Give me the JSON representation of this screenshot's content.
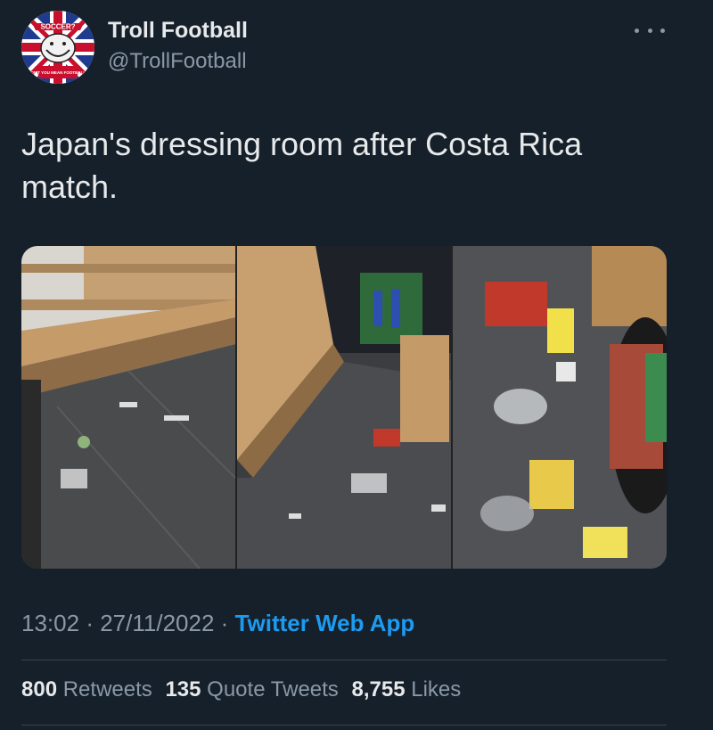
{
  "user": {
    "display_name": "Troll Football",
    "handle": "@TrollFootball",
    "avatar_badge_text": "SOCCER?",
    "avatar_caption": "DON'T YOU MEAN FOOTBALL?"
  },
  "tweet": {
    "text": "Japan's dressing room after Costa Rica match."
  },
  "meta": {
    "time": "13:02",
    "date": "27/11/2022",
    "separator": "·",
    "source": "Twitter Web App"
  },
  "stats": {
    "retweets_count": "800",
    "retweets_label": "Retweets",
    "quotes_count": "135",
    "quotes_label": "Quote Tweets",
    "likes_count": "8,755",
    "likes_label": "Likes"
  },
  "colors": {
    "background": "#15202b",
    "text_primary": "#e7e9ea",
    "text_secondary": "#8b98a5",
    "accent": "#1d9bf0",
    "divider": "#38444d"
  },
  "icons": {
    "more": "more-horizontal-icon",
    "avatar": "union-jack-trollface-avatar"
  }
}
